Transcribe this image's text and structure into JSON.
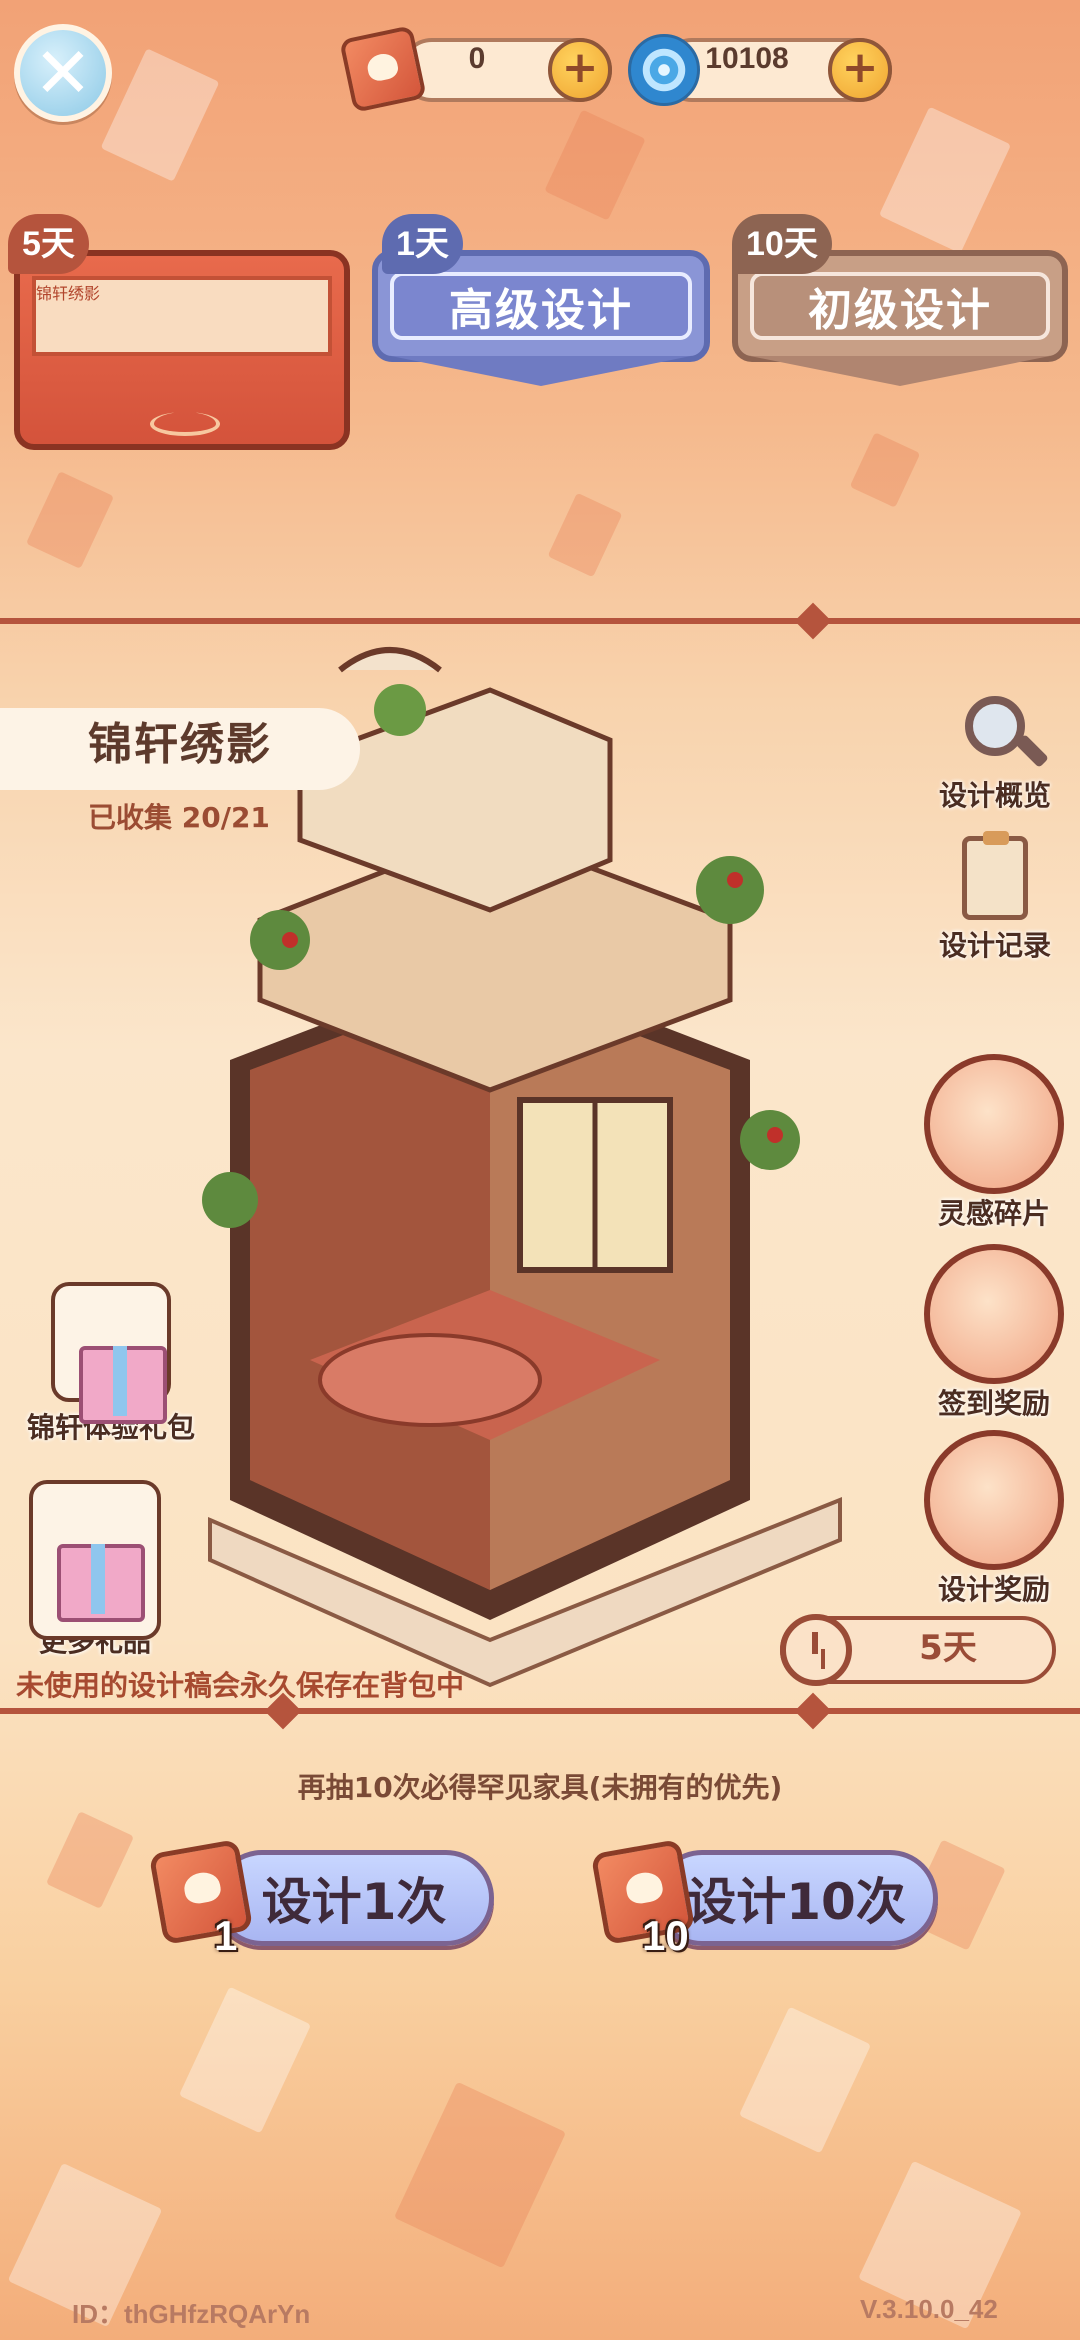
{
  "currencies": [
    {
      "icon": "design-ticket-icon",
      "value": "0"
    },
    {
      "icon": "swirl-coin-icon",
      "value": "10108"
    }
  ],
  "tabs": [
    {
      "label": "锦轩绣影",
      "days": "5天",
      "active": true
    },
    {
      "label": "高级设计",
      "days": "1天",
      "active": false
    },
    {
      "label": "初级设计",
      "days": "10天",
      "active": false
    }
  ],
  "banner": {
    "title": "锦轩绣影",
    "collected": "已收集 20/21",
    "timer": "5天",
    "note": "未使用的设计稿会永久保存在背包中"
  },
  "side_right": [
    {
      "label": "设计概览",
      "icon": "magnifier-icon"
    },
    {
      "label": "设计记录",
      "icon": "clipboard-icon"
    },
    {
      "label": "灵感碎片",
      "icon": "blueprint-fragment-icon"
    },
    {
      "label": "签到奖励",
      "icon": "calendar-icon"
    },
    {
      "label": "设计奖励",
      "icon": "rose-icon"
    }
  ],
  "side_left": [
    {
      "label": "锦轩体验礼包",
      "icon": "gift-pack-icon"
    },
    {
      "label": "更多礼品",
      "icon": "gift-box-icon"
    }
  ],
  "guarantee": "再抽10次必得罕见家具(未拥有的优先)",
  "draw_buttons": [
    {
      "label": "设计1次",
      "cost": "1"
    },
    {
      "label": "设计10次",
      "cost": "10"
    }
  ],
  "footer": {
    "id": "ID：thGHfzRQArYn",
    "version": "V.3.10.0_42"
  },
  "colors": {
    "accent": "#b5543d",
    "active_tab": "#d4533b",
    "blue_tab": "#8a95d6",
    "tan_tab": "#c89f86"
  }
}
